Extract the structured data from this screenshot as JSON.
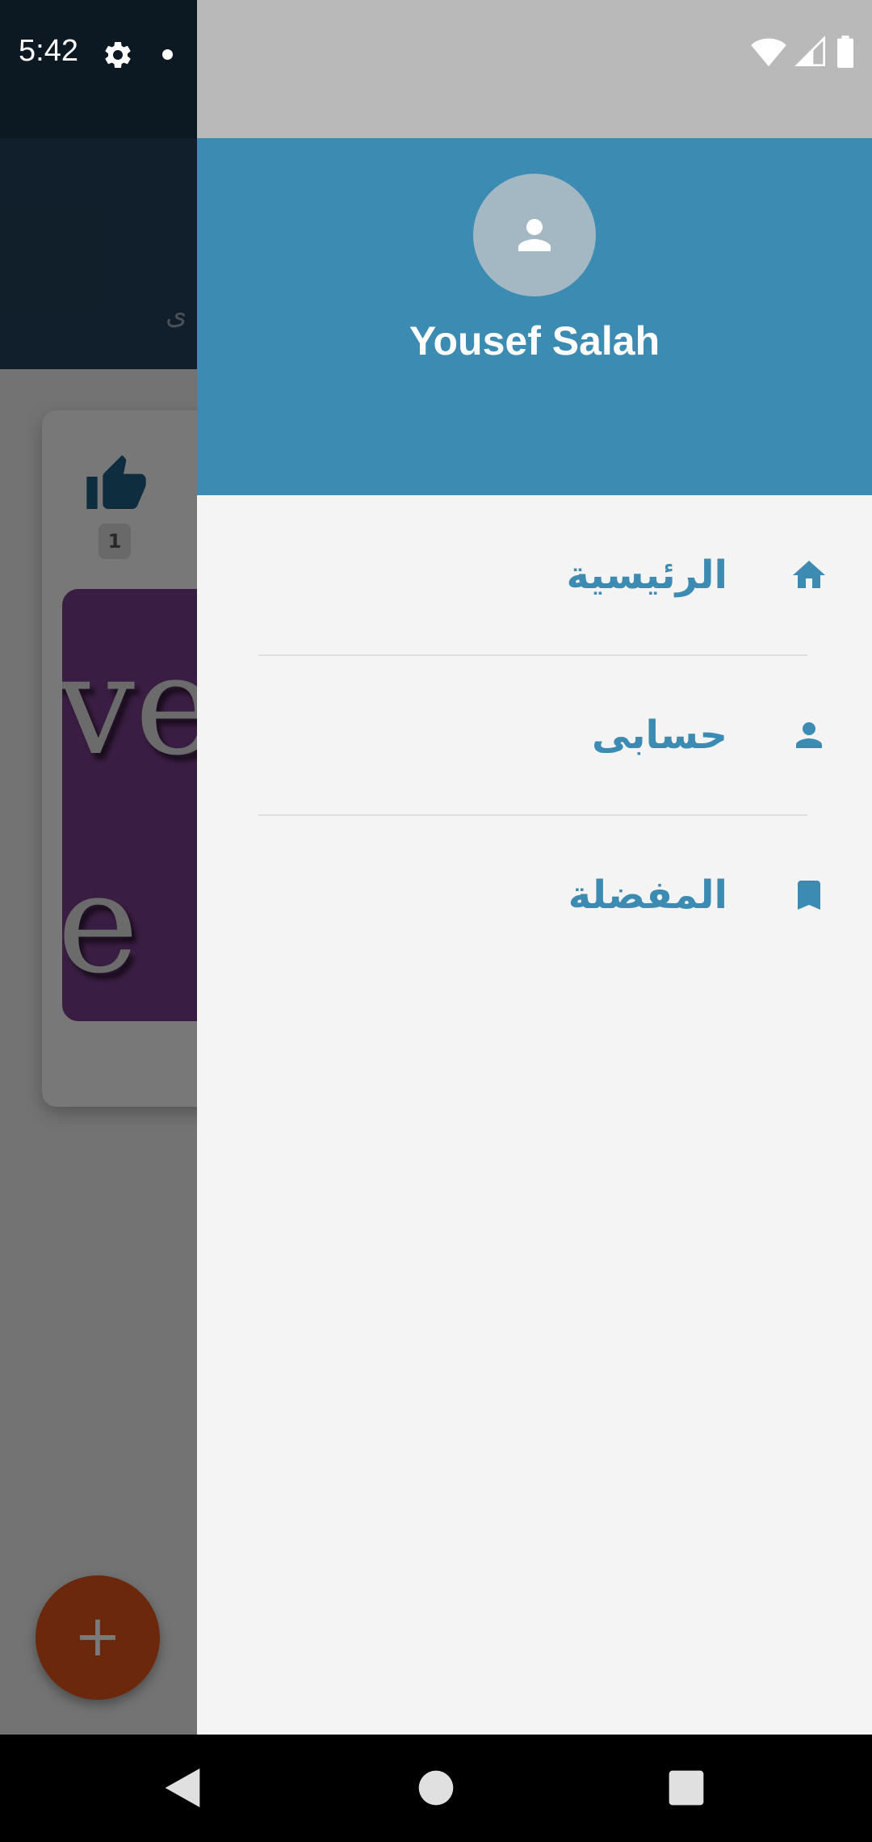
{
  "status_bar": {
    "time": "5:42",
    "icons": [
      "gear-icon",
      "notification-dot-icon",
      "wifi-icon",
      "signal-icon",
      "battery-icon"
    ]
  },
  "background": {
    "appbar_text": "ى",
    "like_count": "1",
    "image_text_line1": "ve",
    "image_text_line2": "e 1",
    "fab_label": "+"
  },
  "drawer": {
    "header_color": "#3b8bb2",
    "user_name": "Yousef Salah",
    "items": [
      {
        "label": "الرئيسية",
        "icon": "home-icon"
      },
      {
        "label": "حسابى",
        "icon": "person-icon"
      },
      {
        "label": "المفضلة",
        "icon": "bookmark-icon"
      }
    ]
  },
  "nav_bar": {
    "buttons": [
      "back-icon",
      "home-circle-icon",
      "recents-icon"
    ]
  }
}
